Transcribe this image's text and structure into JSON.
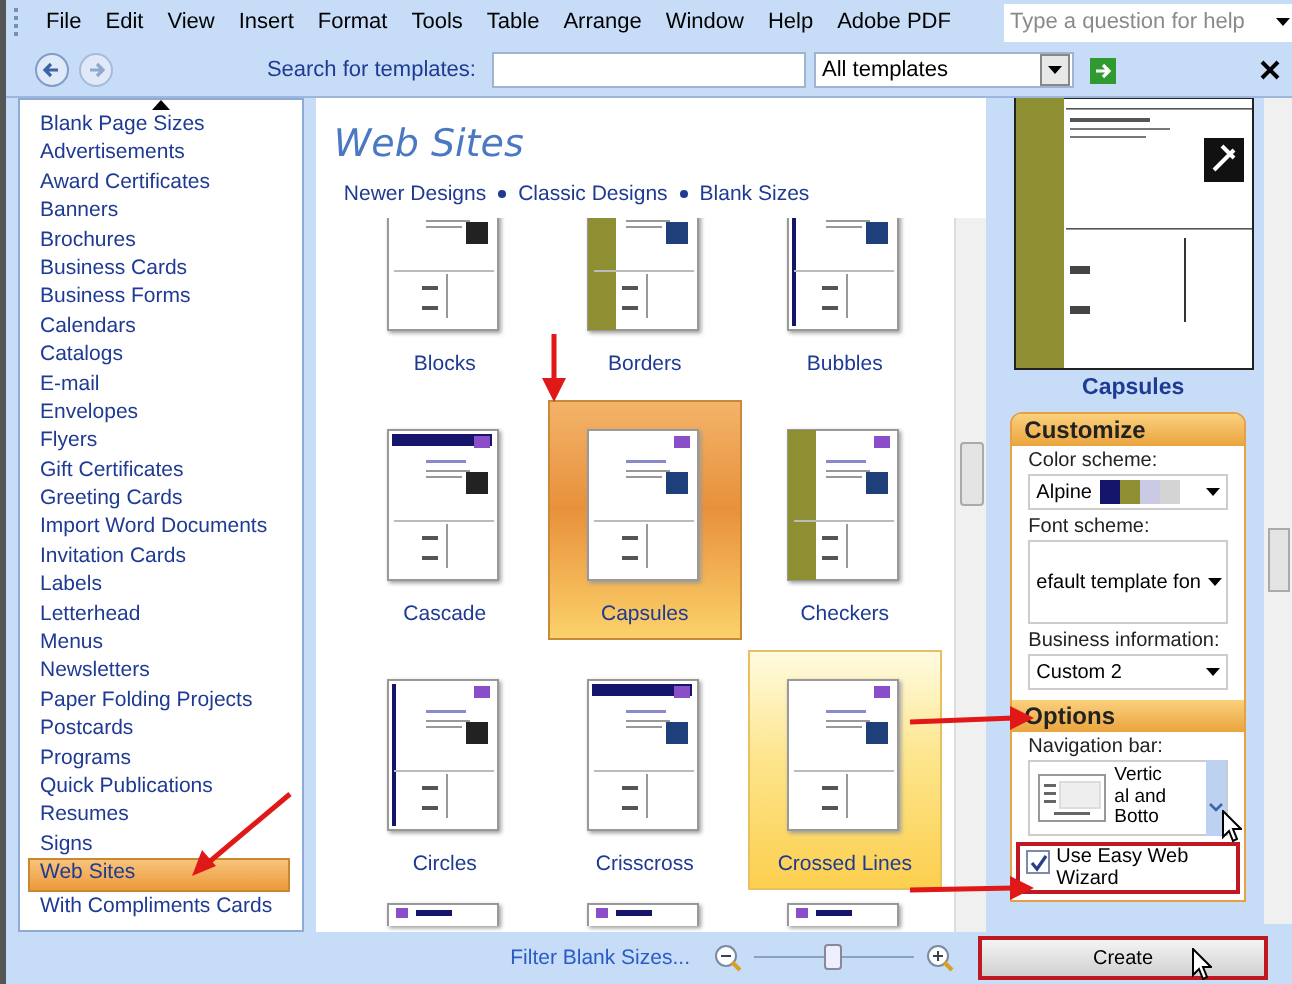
{
  "menu": {
    "items": [
      "File",
      "Edit",
      "View",
      "Insert",
      "Format",
      "Tools",
      "Table",
      "Arrange",
      "Window",
      "Help",
      "Adobe PDF"
    ],
    "help_box": {
      "placeholder": "Type a question for help"
    }
  },
  "toolbar": {
    "search_label": "Search for templates:",
    "scope": "All templates"
  },
  "categories": [
    {
      "label": "Blank Page Sizes",
      "selected": false
    },
    {
      "label": "Advertisements",
      "selected": false
    },
    {
      "label": "Award Certificates",
      "selected": false
    },
    {
      "label": "Banners",
      "selected": false
    },
    {
      "label": "Brochures",
      "selected": false
    },
    {
      "label": "Business Cards",
      "selected": false
    },
    {
      "label": "Business Forms",
      "selected": false
    },
    {
      "label": "Calendars",
      "selected": false
    },
    {
      "label": "Catalogs",
      "selected": false
    },
    {
      "label": "E-mail",
      "selected": false
    },
    {
      "label": "Envelopes",
      "selected": false
    },
    {
      "label": "Flyers",
      "selected": false
    },
    {
      "label": "Gift Certificates",
      "selected": false
    },
    {
      "label": "Greeting Cards",
      "selected": false
    },
    {
      "label": "Import Word Documents",
      "selected": false
    },
    {
      "label": "Invitation Cards",
      "selected": false
    },
    {
      "label": "Labels",
      "selected": false
    },
    {
      "label": "Letterhead",
      "selected": false
    },
    {
      "label": "Menus",
      "selected": false
    },
    {
      "label": "Newsletters",
      "selected": false
    },
    {
      "label": "Paper Folding Projects",
      "selected": false
    },
    {
      "label": "Postcards",
      "selected": false
    },
    {
      "label": "Programs",
      "selected": false
    },
    {
      "label": "Quick Publications",
      "selected": false
    },
    {
      "label": "Resumes",
      "selected": false
    },
    {
      "label": "Signs",
      "selected": false
    },
    {
      "label": "Web Sites",
      "selected": true
    },
    {
      "label": "With Compliments Cards",
      "selected": false
    }
  ],
  "gallery": {
    "title": "Web Sites",
    "links": [
      "Newer Designs",
      "Classic Designs",
      "Blank Sizes"
    ],
    "templates": [
      {
        "name": "Blocks",
        "selected": false,
        "hovered": false
      },
      {
        "name": "Borders",
        "selected": false,
        "hovered": false
      },
      {
        "name": "Bubbles",
        "selected": false,
        "hovered": false
      },
      {
        "name": "Cascade",
        "selected": false,
        "hovered": false
      },
      {
        "name": "Capsules",
        "selected": true,
        "hovered": false
      },
      {
        "name": "Checkers",
        "selected": false,
        "hovered": false
      },
      {
        "name": "Circles",
        "selected": false,
        "hovered": false
      },
      {
        "name": "Crisscross",
        "selected": false,
        "hovered": false
      },
      {
        "name": "Crossed Lines",
        "selected": false,
        "hovered": true
      }
    ],
    "more_below": true
  },
  "preview": {
    "name": "Capsules"
  },
  "customize": {
    "title": "Customize",
    "color_scheme_label": "Color scheme:",
    "color_scheme": "Alpine",
    "swatches": [
      {
        "color": "#15166b"
      },
      {
        "color": "#8e8f33"
      },
      {
        "color": "#c9c9e3"
      },
      {
        "color": "#d4d4d4"
      }
    ],
    "font_scheme_label": "Font scheme:",
    "font_scheme": "efault template fon",
    "business_label": "Business information:",
    "business": "Custom 2"
  },
  "options": {
    "title": "Options",
    "nav_label": "Navigation bar:",
    "nav_value": "Vertical and Botto",
    "wizard_label": "Use Easy Web Wizard",
    "wizard_checked": true
  },
  "footer": {
    "filter_link": "Filter Blank Sizes...",
    "zoom": {
      "level": 0.5
    },
    "create": "Create"
  }
}
